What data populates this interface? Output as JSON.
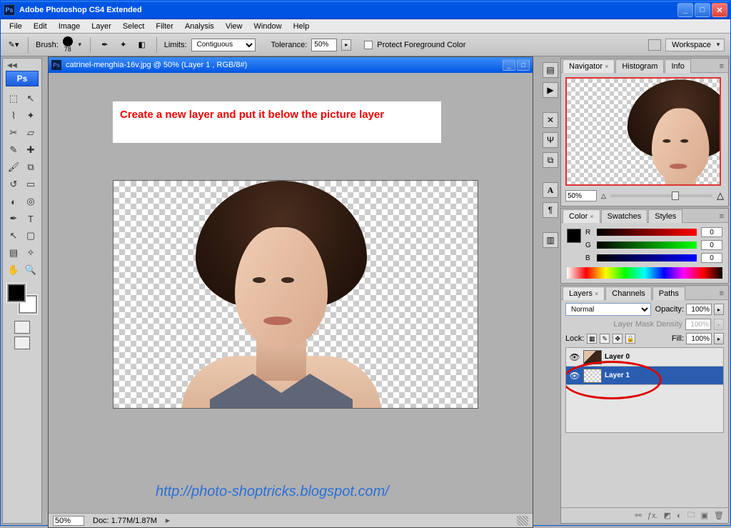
{
  "window": {
    "title": "Adobe Photoshop CS4 Extended"
  },
  "menu": {
    "items": [
      "File",
      "Edit",
      "Image",
      "Layer",
      "Select",
      "Filter",
      "Analysis",
      "View",
      "Window",
      "Help"
    ]
  },
  "options": {
    "brush_label": "Brush:",
    "brush_size": "78",
    "limits_label": "Limits:",
    "limits_value": "Contiguous",
    "tolerance_label": "Tolerance:",
    "tolerance_value": "50%",
    "protect_fg_label": "Protect Foreground Color",
    "workspace_label": "Workspace"
  },
  "toolbox": {
    "badge": "Ps"
  },
  "document": {
    "title": "catrinel-menghia-16v.jpg @ 50% (Layer 1 , RGB/8#)",
    "instruction": "Create a new layer and put it below the picture layer",
    "status_zoom": "50%",
    "status_doc": "Doc: 1.77M/1.87M",
    "url": "http://photo-shoptricks.blogspot.com/"
  },
  "navigator": {
    "tabs": [
      "Navigator",
      "Histogram",
      "Info"
    ],
    "zoom": "50%"
  },
  "color": {
    "tabs": [
      "Color",
      "Swatches",
      "Styles"
    ],
    "r_label": "R",
    "g_label": "G",
    "b_label": "B",
    "r": "0",
    "g": "0",
    "b": "0"
  },
  "layers": {
    "tabs": [
      "Layers",
      "Channels",
      "Paths"
    ],
    "blend_mode": "Normal",
    "opacity_label": "Opacity:",
    "opacity": "100%",
    "mask_label": "Layer Mask Density",
    "mask_value": "100%",
    "lock_label": "Lock:",
    "fill_label": "Fill:",
    "fill": "100%",
    "items": [
      {
        "name": "Layer 0"
      },
      {
        "name": "Layer 1"
      }
    ]
  }
}
